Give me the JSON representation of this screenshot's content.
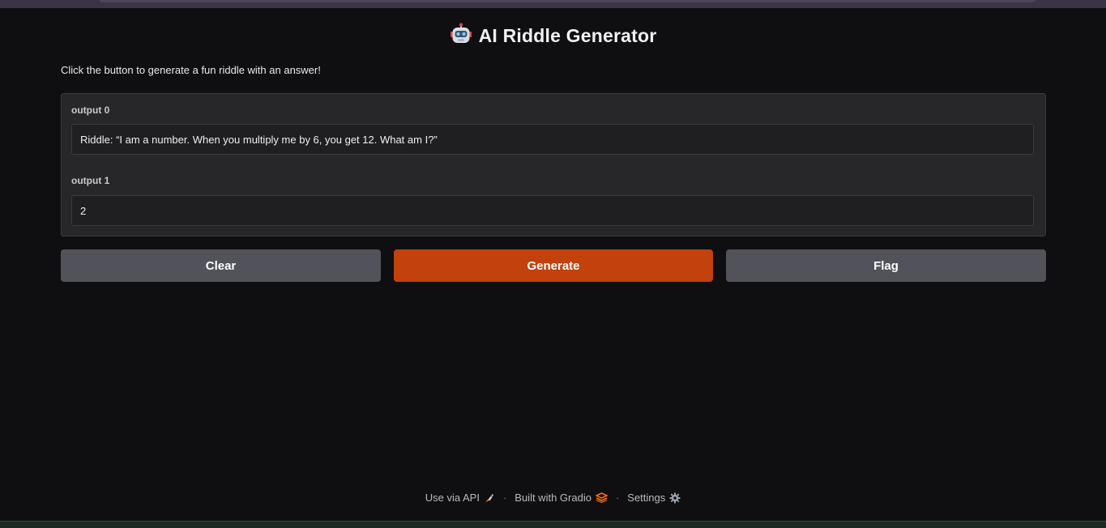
{
  "app": {
    "title": "AI Riddle Generator",
    "title_icon": "robot-icon",
    "description": "Click the button to generate a fun riddle with an answer!"
  },
  "outputs": [
    {
      "label": "output 0",
      "value": "Riddle: “I am a number. When you multiply me by 6, you get 12. What am I?”"
    },
    {
      "label": "output 1",
      "value": "2"
    }
  ],
  "buttons": {
    "clear": "Clear",
    "generate": "Generate",
    "flag": "Flag"
  },
  "footer": {
    "api": "Use via API",
    "api_icon": "rocket-icon",
    "built": "Built with Gradio",
    "built_icon": "gradio-logo-icon",
    "settings": "Settings",
    "settings_icon": "gear-icon",
    "separator": "·"
  },
  "colors": {
    "background": "#0f0f11",
    "panel": "#27272a",
    "primary": "#c2410c",
    "secondary": "#52525b"
  }
}
